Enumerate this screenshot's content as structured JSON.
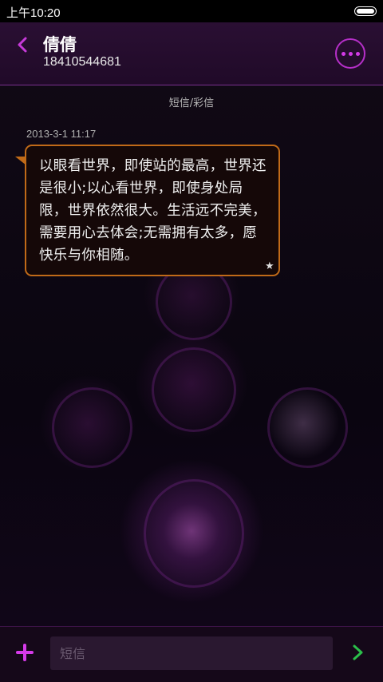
{
  "status_bar": {
    "time": "上午10:20"
  },
  "header": {
    "contact_name": "倩倩",
    "phone_number": "18410544681",
    "back_icon": "chevron-left-icon",
    "more_icon": "more-dots-icon"
  },
  "conversation": {
    "message_type_label": "短信/彩信",
    "messages": [
      {
        "timestamp": "2013-3-1 11:17",
        "text": "以眼看世界，即使站的最高，世界还是很小;以心看世界，即使身处局限，世界依然很大。生活远不完美，需要用心去体会;无需拥有太多，愿快乐与你相随。",
        "starred": true
      }
    ]
  },
  "composer": {
    "placeholder": "短信",
    "add_icon": "plus-icon",
    "send_icon": "send-arrow-icon"
  },
  "colors": {
    "accent": "#c63ad9",
    "bubble_border": "#c06a18",
    "send": "#2bbf4a"
  }
}
